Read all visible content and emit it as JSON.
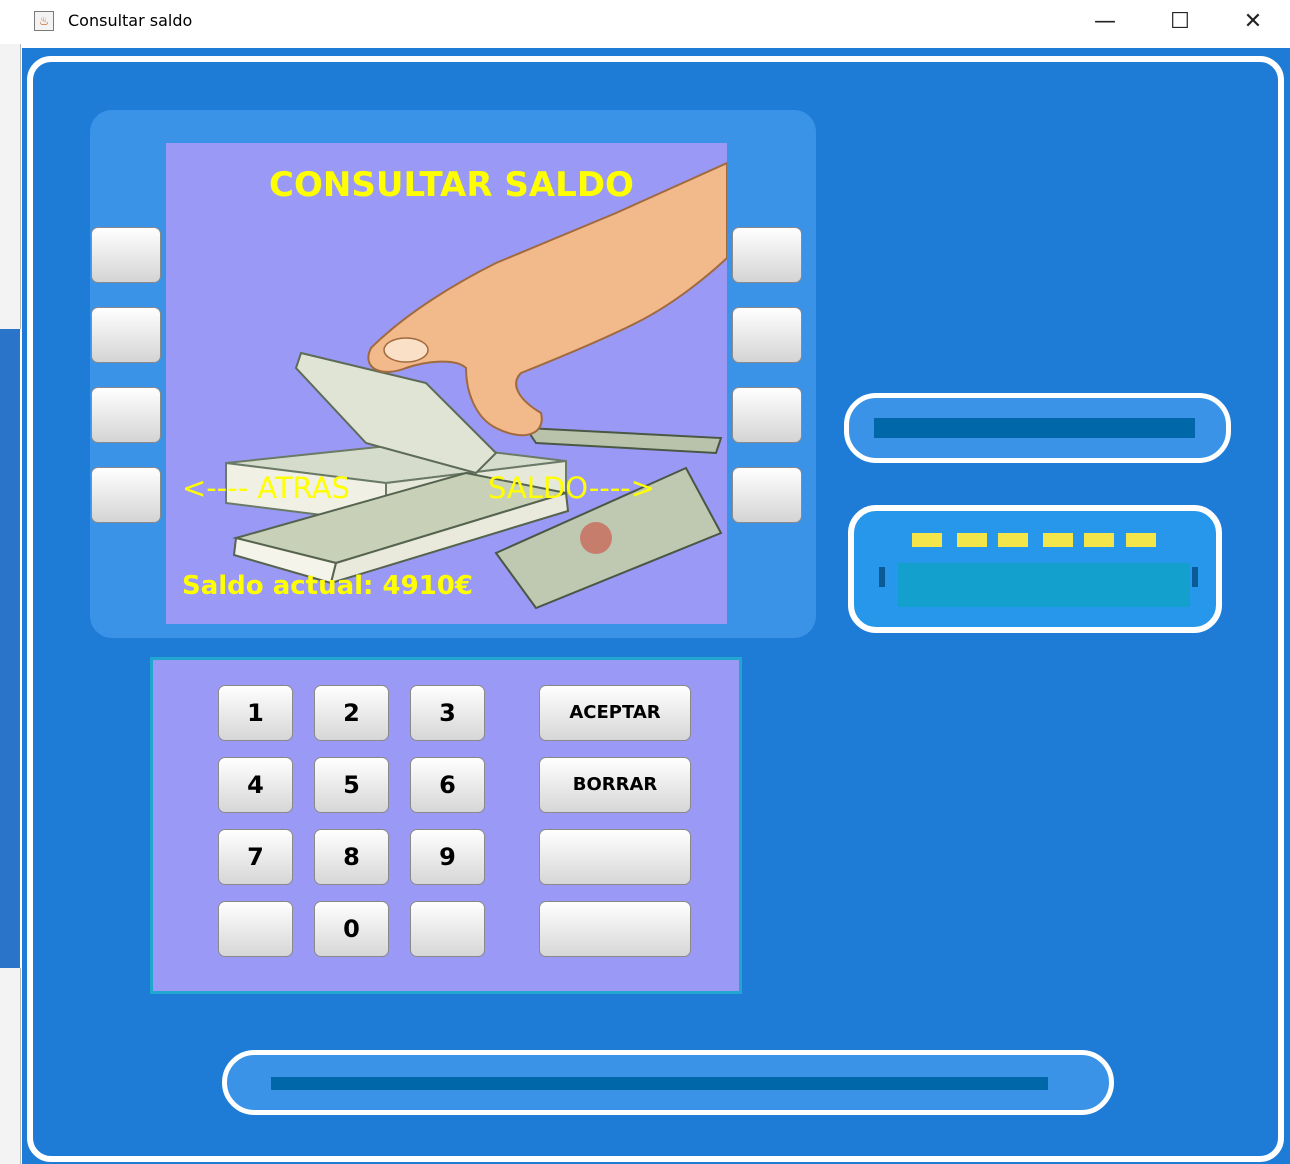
{
  "window": {
    "title": "Consultar saldo",
    "icon_name": "java-coffee-icon",
    "minimize_glyph": "—",
    "maximize_glyph": "☐",
    "close_glyph": "✕"
  },
  "screen": {
    "title": "CONSULTAR SALDO",
    "nav_back": "<----  ATRAS",
    "nav_balance": "SALDO---->",
    "balance_text": "Saldo actual: 4910€",
    "image": "hand-counting-money-illustration"
  },
  "keypad": {
    "digits": [
      "1",
      "2",
      "3",
      "4",
      "5",
      "6",
      "7",
      "8",
      "9",
      "",
      "0",
      ""
    ],
    "accept_label": "ACEPTAR",
    "delete_label": "BORRAR",
    "blank_label_1": "",
    "blank_label_2": ""
  },
  "colors": {
    "background": "#1f7cd6",
    "screen": "#9a9af6",
    "screen_text": "#ffff00",
    "slot_bar": "#0068a8",
    "card": "#14a0cc",
    "card_dash": "#f4e54a"
  }
}
